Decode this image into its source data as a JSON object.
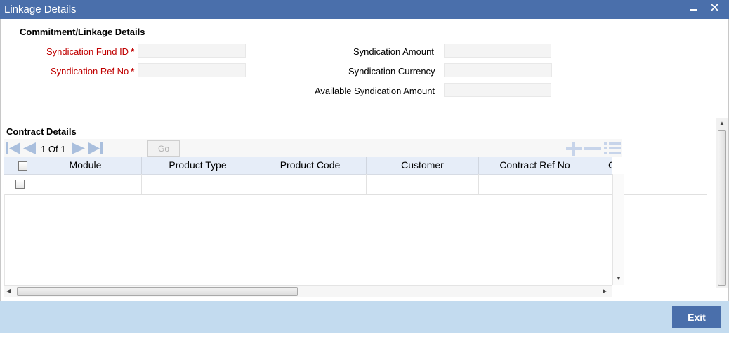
{
  "window": {
    "title": "Linkage Details"
  },
  "sections": {
    "commitment": "Commitment/Linkage Details",
    "contract": "Contract Details"
  },
  "form": {
    "syndication_fund_id_label": "Syndication Fund ID",
    "syndication_ref_no_label": "Syndication Ref No",
    "required_marker": "*",
    "syndication_amount_label": "Syndication Amount",
    "syndication_currency_label": "Syndication Currency",
    "available_syndication_amount_label": "Available Syndication Amount",
    "syndication_fund_id_value": "",
    "syndication_ref_no_value": "",
    "syndication_amount_value": "",
    "syndication_currency_value": "",
    "available_syndication_amount_value": ""
  },
  "grid": {
    "pager": {
      "current": "1",
      "of_label": "Of",
      "total": "1",
      "go_label": "Go"
    },
    "columns": [
      "Module",
      "Product Type",
      "Product Code",
      "Customer",
      "Contract Ref No",
      "C"
    ]
  },
  "footer": {
    "exit_label": "Exit"
  },
  "colors": {
    "accent": "#4a6fab",
    "footer": "#c3dbef",
    "required": "#c00000"
  }
}
